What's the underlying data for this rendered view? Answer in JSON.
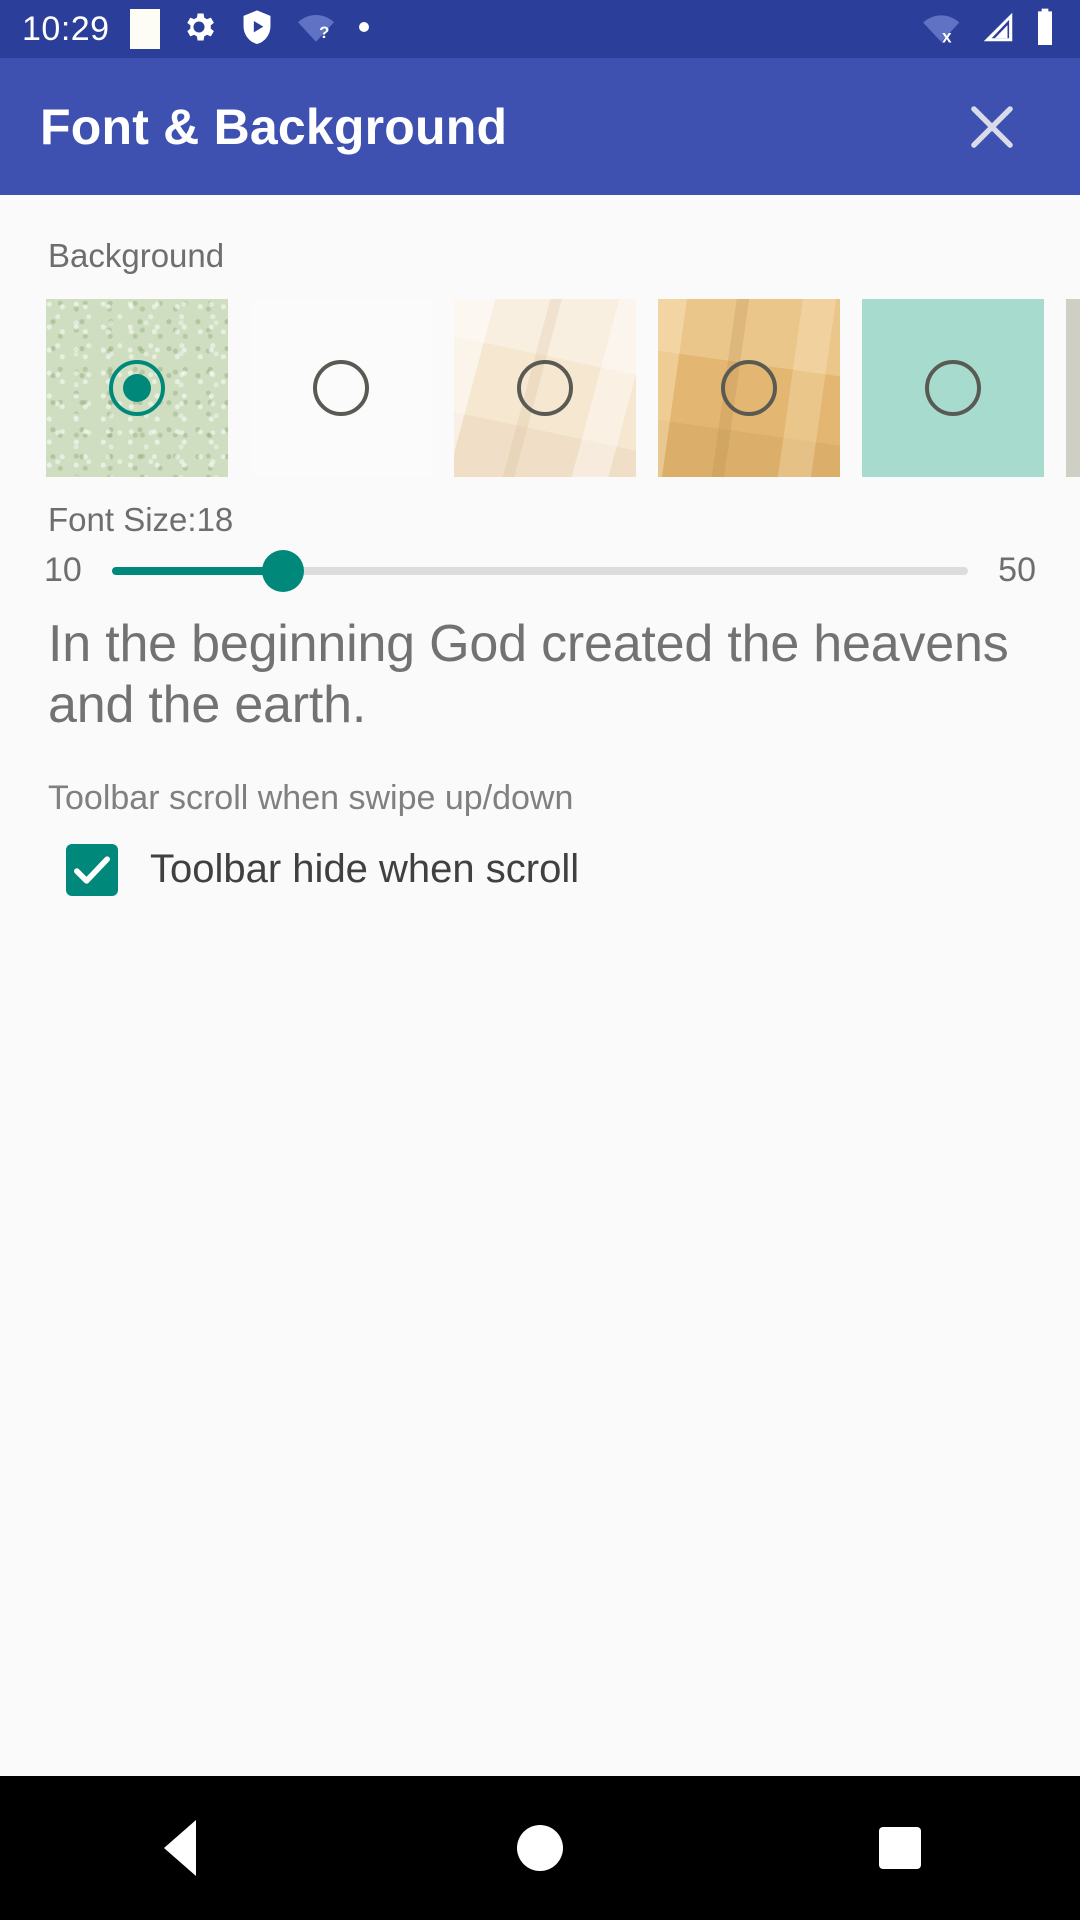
{
  "status_bar": {
    "time": "10:29",
    "left_icons": [
      "white-square-icon",
      "gear-icon",
      "play-shield-icon",
      "wifi-question-icon",
      "dot-icon"
    ],
    "right_icons": [
      "wifi-off-icon",
      "cellular-signal-icon",
      "battery-icon"
    ],
    "background_color": "#2b3e99"
  },
  "app_bar": {
    "title": "Font & Background",
    "close_icon": "close-icon",
    "background_color": "#3f51b0",
    "title_color": "#ffffff"
  },
  "background_section": {
    "label": "Background",
    "accent_color": "#00897b",
    "swatches": [
      {
        "name": "green-texture",
        "color": "#cfdec0",
        "selected": true
      },
      {
        "name": "white-plain",
        "color": "#fbfbfb",
        "selected": false
      },
      {
        "name": "cream-parchment",
        "color": "#f6e7d1",
        "selected": false
      },
      {
        "name": "tan-parchment",
        "color": "#e3b671",
        "selected": false
      },
      {
        "name": "mint-green",
        "color": "#a7dbce",
        "selected": false
      },
      {
        "name": "gray-partial",
        "color": "#cfcfc6",
        "selected": false
      }
    ]
  },
  "font_size": {
    "label": "Font Size:18",
    "value": 18,
    "min_label": "10",
    "max_label": "50",
    "min": 10,
    "max": 50,
    "fill_percent": 20,
    "track_color": "#dcdcdc",
    "fill_color": "#00897b"
  },
  "preview": {
    "text": "In the beginning God created the heavens and the earth."
  },
  "toolbar_section": {
    "label": "Toolbar scroll when swipe up/down",
    "checkbox_label": "Toolbar hide when scroll",
    "checked": true,
    "checkbox_color": "#00897b"
  },
  "nav_bar": {
    "back_icon": "back-triangle-icon",
    "home_icon": "home-circle-icon",
    "recents_icon": "recents-square-icon",
    "background_color": "#000000"
  }
}
